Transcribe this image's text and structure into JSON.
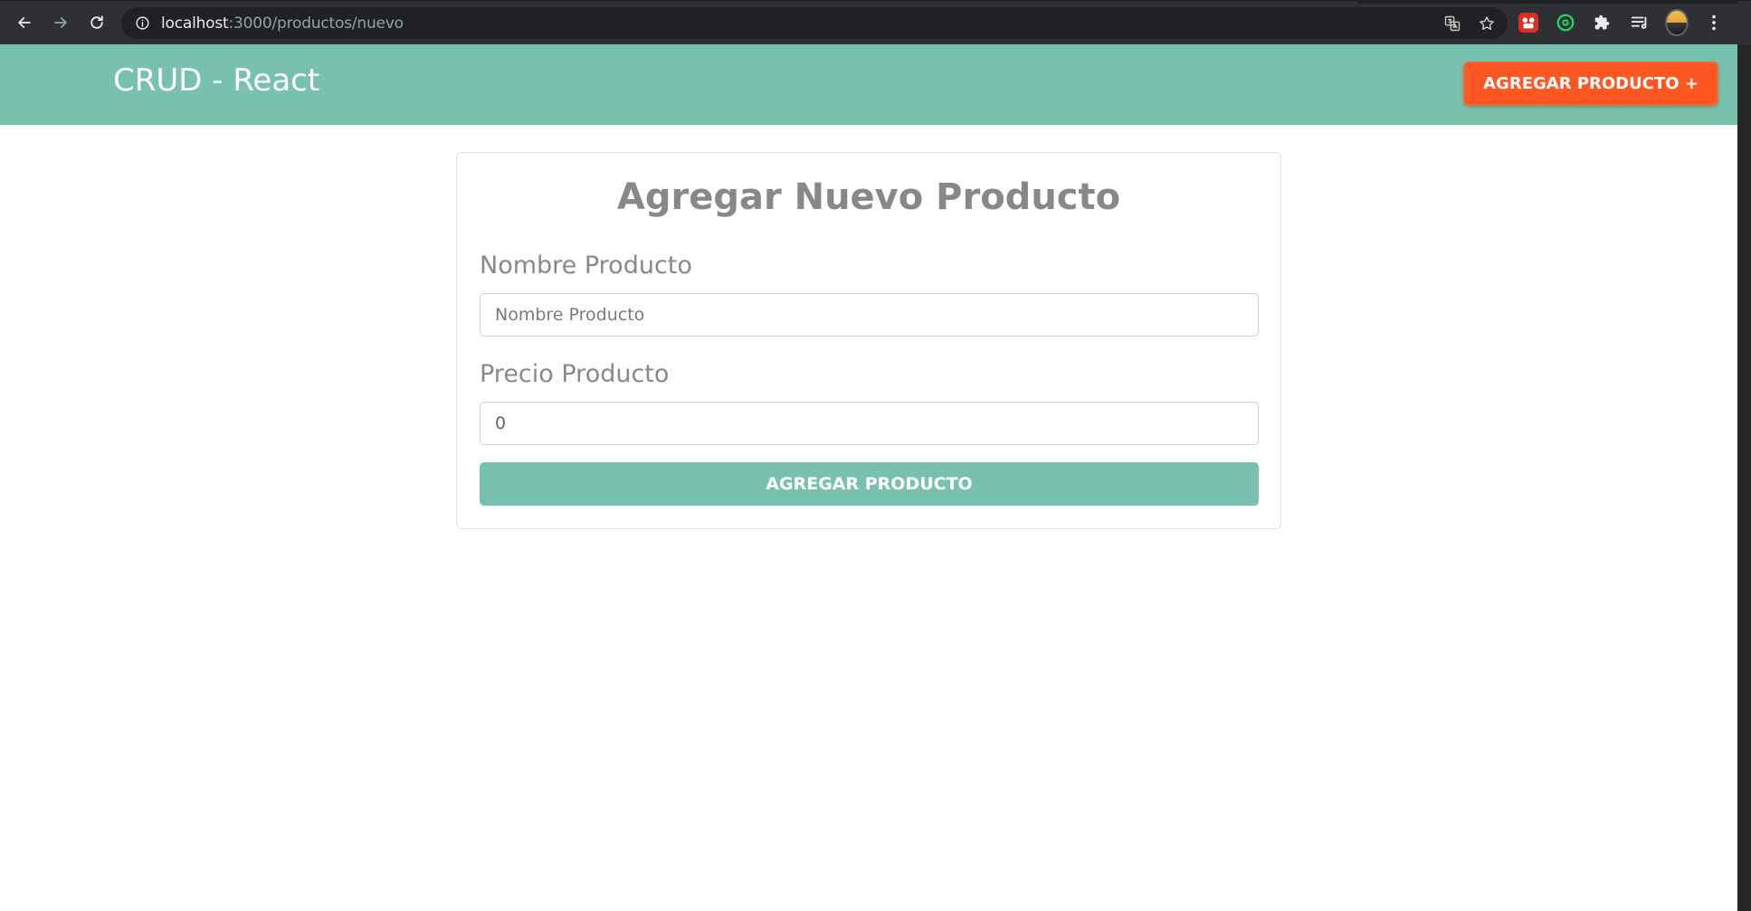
{
  "browser": {
    "url_host": "localhost",
    "url_path": ":3000/productos/nuevo",
    "icons": [
      "back-arrow-icon",
      "forward-arrow-icon",
      "reload-icon",
      "info-icon",
      "translate-icon",
      "star-icon",
      "extension-red-icon",
      "extension-green-ring-icon",
      "puzzle-icon",
      "reading-list-icon",
      "profile-avatar",
      "kebab-menu-icon"
    ]
  },
  "header": {
    "brand": "CRUD - React",
    "add_button_label": "AGREGAR PRODUCTO +",
    "background": "#78c2ad",
    "button_color": "#ff5722"
  },
  "form": {
    "title": "Agregar Nuevo Producto",
    "nombre_label": "Nombre Producto",
    "nombre_placeholder": "Nombre Producto",
    "nombre_value": "",
    "precio_label": "Precio Producto",
    "precio_value": "0",
    "submit_label": "AGREGAR PRODUCTO",
    "submit_color": "#78c2ad"
  }
}
